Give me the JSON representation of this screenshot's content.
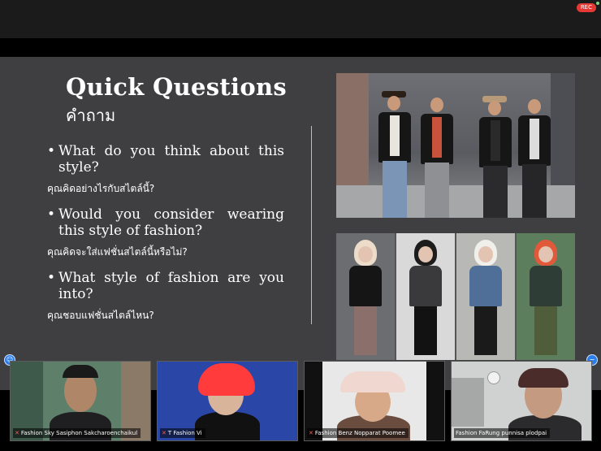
{
  "recording": {
    "label": "REC"
  },
  "slide": {
    "title": "Quick Questions",
    "subtitle": "คำถาม",
    "questions": [
      {
        "en": "What do you think about this style?",
        "th": "คุณคิดอย่างไรกับสไตล์นี้?"
      },
      {
        "en": "Would you consider wearing this style of fashion?",
        "th": "คุณคิดจะใส่แฟชั่นสไตล์นี้หรือไม่?"
      },
      {
        "en": "What style of fashion are you into?",
        "th": "คุณชอบแฟชั่นสไตล์ไหน?"
      }
    ]
  },
  "gallery": {
    "participants": [
      {
        "name": "Fashion Sky Sasiphon Sakcharoenchaikul",
        "muted": true
      },
      {
        "name": "T Fashion Vi",
        "muted": true
      },
      {
        "name": "Fashion Benz Nopparat Poomee",
        "muted": true
      },
      {
        "name": "Fashion FaRung punnisa plodpai",
        "muted": false
      }
    ]
  },
  "icons": {
    "left": "participants-icon",
    "right": "minimize-icon",
    "mic": "muted-mic-icon"
  },
  "colors": {
    "slide_bg": "#3f3f41",
    "rec": "#e53935",
    "accent": "#2b7de9"
  }
}
